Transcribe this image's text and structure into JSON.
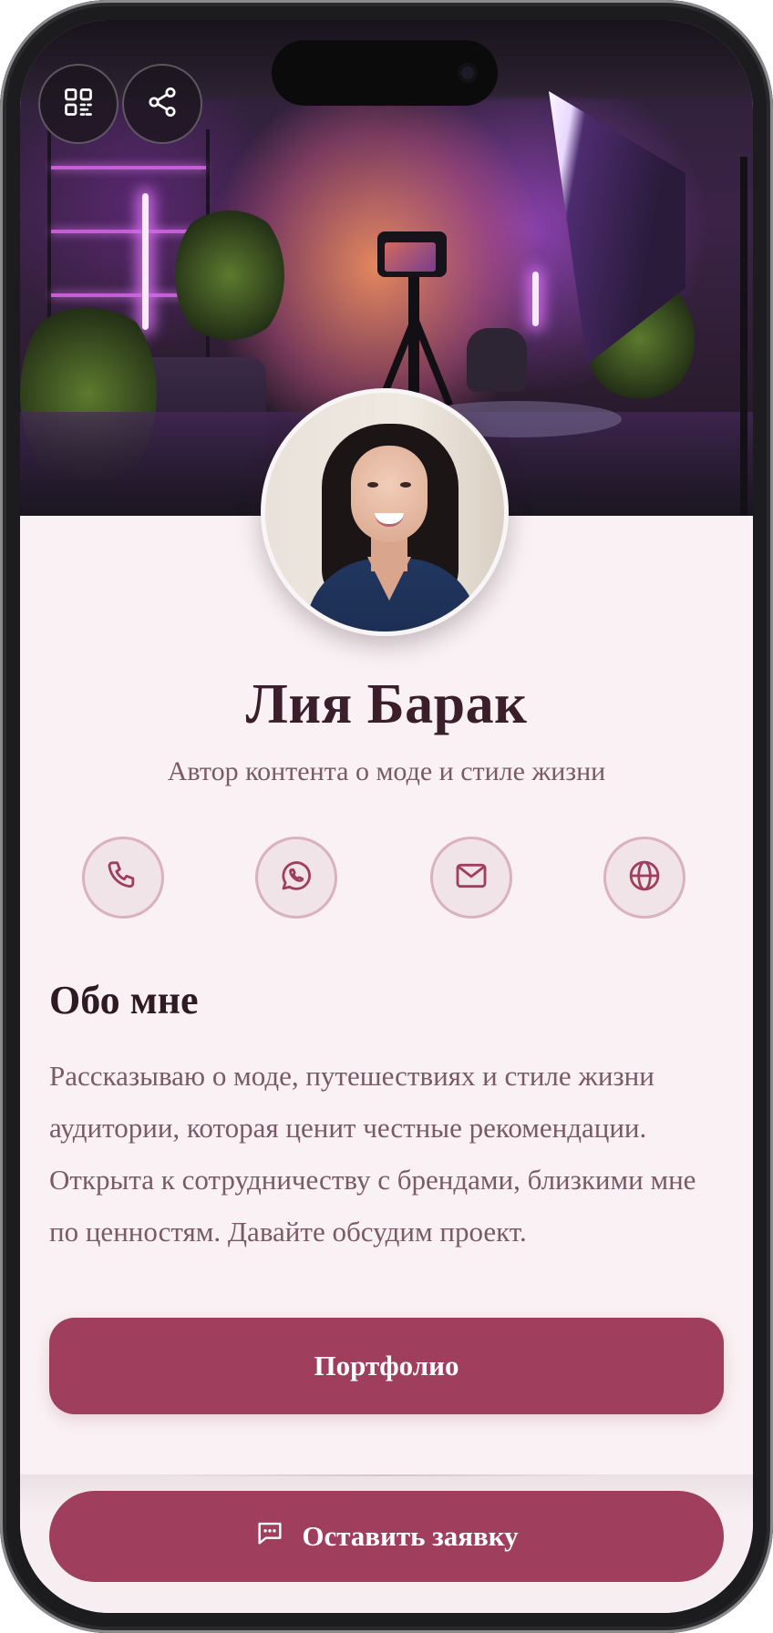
{
  "profile": {
    "name": "Лия Барак",
    "subtitle": "Автор контента о моде и стиле жизни"
  },
  "header_actions": {
    "qr_icon": "qr-code-icon",
    "share_icon": "share-icon"
  },
  "contacts": [
    {
      "icon": "phone-icon"
    },
    {
      "icon": "whatsapp-icon"
    },
    {
      "icon": "mail-icon"
    },
    {
      "icon": "globe-icon"
    }
  ],
  "about": {
    "title": "Обо мне",
    "text": "Рассказываю о моде, путешествиях и стиле жизни аудитории, которая ценит честные рекомендации. Открыта к сотрудничеству с брендами, близкими мне по ценностям. Давайте обсудим проект."
  },
  "buttons": {
    "portfolio": "Портфолио",
    "request": "Оставить заявку",
    "request_icon": "message-icon"
  },
  "colors": {
    "accent": "#a03e5e",
    "background": "#f9f1f3",
    "heading": "#3a1f2b",
    "muted_text": "#7a5a66",
    "contact_border": "#d9b1bf"
  }
}
